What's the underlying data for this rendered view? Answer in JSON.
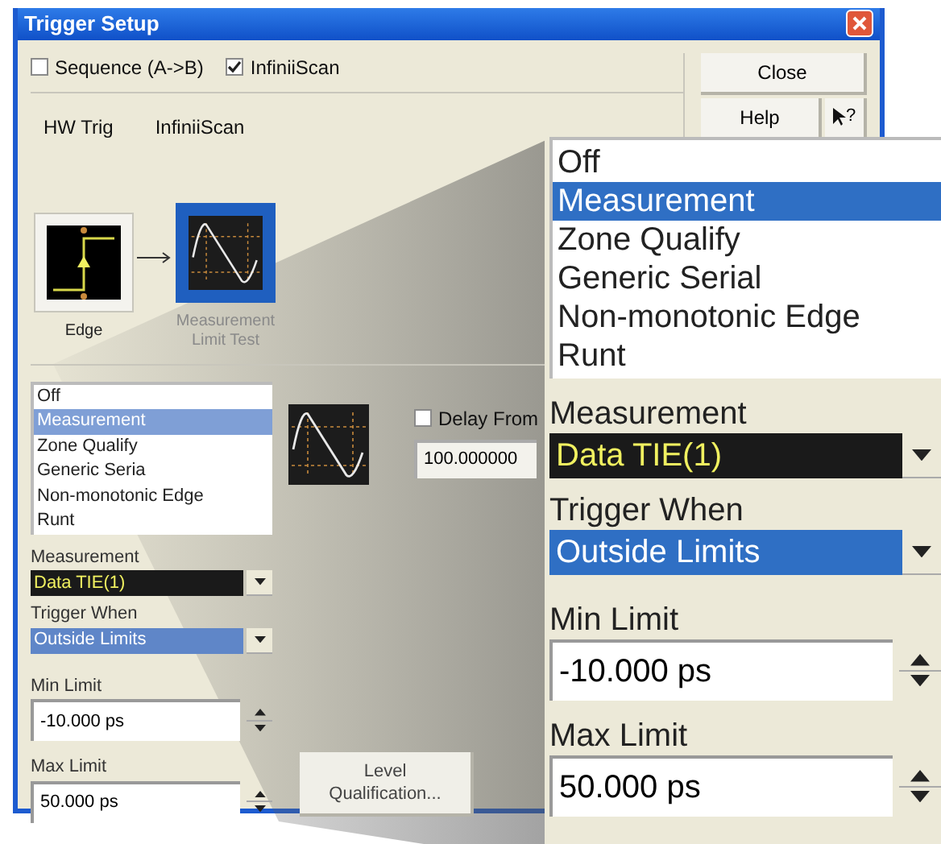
{
  "window": {
    "title": "Trigger Setup"
  },
  "options": [
    {
      "label": "Sequence (A->B)",
      "checked": false
    },
    {
      "label": "InfiniiScan",
      "checked": true
    }
  ],
  "buttons": {
    "close": "Close",
    "help": "Help",
    "whats_this": "?"
  },
  "chain_headers": [
    "HW Trig",
    "InfiniiScan"
  ],
  "chain": [
    {
      "kind": "edge",
      "label": "Edge",
      "selected": false
    },
    {
      "kind": "measurement",
      "label": "Measurement Limit Test",
      "selected": true
    }
  ],
  "panel": {
    "modes": [
      {
        "label": "Off",
        "selected": false
      },
      {
        "label": "Measurement",
        "selected": true
      },
      {
        "label": "Zone Qualify",
        "selected": false
      },
      {
        "label": "Generic Seria",
        "selected": false
      },
      {
        "label": "Non-monotonic Edge",
        "selected": false
      },
      {
        "label": "Runt",
        "selected": false
      }
    ],
    "measurement": {
      "label": "Measurement",
      "value": "Data TIE(1)"
    },
    "trigger_when": {
      "label": "Trigger When",
      "value": "Outside Limits"
    },
    "min_limit": {
      "label": "Min Limit",
      "value": "-10.000 ps"
    },
    "max_limit": {
      "label": "Max Limit",
      "value": "50.000 ps"
    },
    "delay": {
      "label": "Delay From",
      "checked": false,
      "value": "100.000000"
    },
    "level_button": "Level Qualification..."
  },
  "magnifier": {
    "modes": [
      {
        "label": "Off",
        "selected": false
      },
      {
        "label": "Measurement",
        "selected": true
      },
      {
        "label": "Zone Qualify",
        "selected": false
      },
      {
        "label": "Generic Serial",
        "selected": false
      },
      {
        "label": "Non-monotonic Edge",
        "selected": false
      },
      {
        "label": "Runt",
        "selected": false
      }
    ],
    "measurement": {
      "label": "Measurement",
      "value": "Data TIE(1)"
    },
    "trigger_when": {
      "label": "Trigger When",
      "value": "Outside Limits"
    },
    "min_limit": {
      "label": "Min Limit",
      "value": "-10.000 ps"
    },
    "max_limit": {
      "label": "Max Limit",
      "value": "50.000 ps"
    }
  }
}
